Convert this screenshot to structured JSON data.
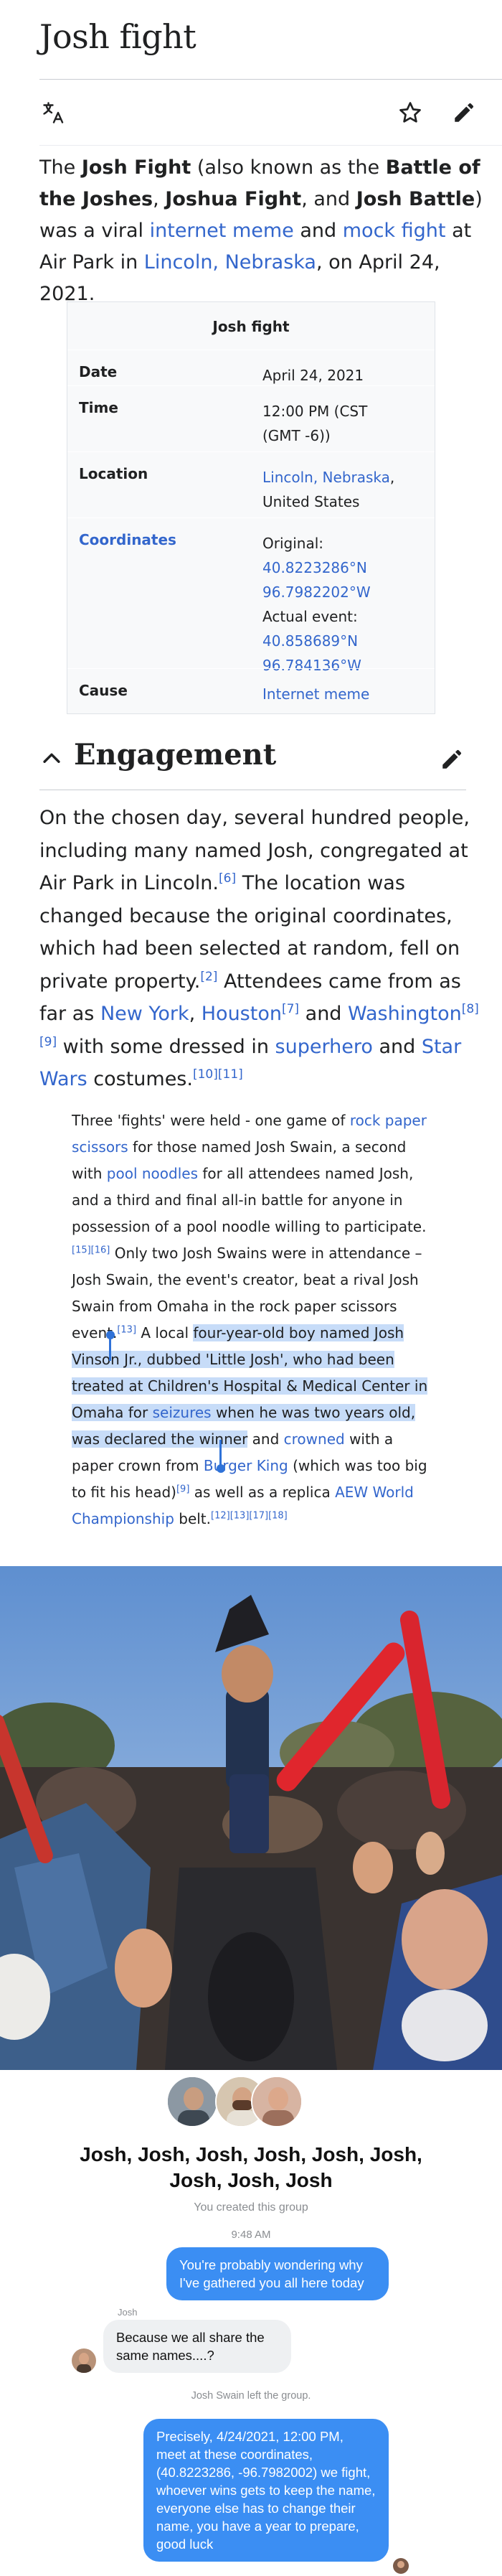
{
  "page": {
    "title": "Josh fight"
  },
  "toolbar": {
    "icons": [
      "translate-icon",
      "star-icon",
      "pencil-icon"
    ]
  },
  "lead": {
    "t1": "The ",
    "b1": "Josh Fight",
    "t2": " (also known as the ",
    "b2": "Battle of the Joshes",
    "t3": ", ",
    "b3": "Joshua Fight",
    "t4": ", and ",
    "b4": "Josh Battle",
    "t5": ") was a viral ",
    "l1": "internet meme",
    "t6": " and ",
    "l2": "mock fight",
    "t7": " at Air Park in ",
    "l3": "Lincoln, Nebraska",
    "t8": ", on April 24, 2021."
  },
  "infobox": {
    "title": "Josh fight",
    "rows": [
      {
        "label": "Date",
        "value": "April 24, 2021"
      },
      {
        "label": "Time",
        "value": "12:00 PM (CST (GMT -6))"
      },
      {
        "label": "Location",
        "value_link": "Lincoln, Nebraska",
        "value_rest": ", United States"
      },
      {
        "label": "Coordinates",
        "original_label": "Original:",
        "original_lat": "40.8223286°N",
        "original_lon": "96.7982202°W",
        "actual_label": "Actual event:",
        "actual_lat": "40.858689°N",
        "actual_lon": "96.784136°W"
      },
      {
        "label": "Cause",
        "value": "Internet meme"
      }
    ]
  },
  "section": {
    "title": "Engagement"
  },
  "engagement": {
    "t1": "On the chosen day, several hundred people, including many named Josh, congregated at Air Park in Lincoln.",
    "r1": "[6]",
    "t2": " The location was changed because the original coordinates, which had been selected at random, fell on private property.",
    "r2": "[2]",
    "t3": " Attendees came from as far as ",
    "l1": "New York",
    "t4": ", ",
    "l2": "Houston",
    "r3": "[7]",
    "t5": " and ",
    "l3": "Washington",
    "r4": "[8][9]",
    "t6": " with some dressed in ",
    "l4": "superhero",
    "t7": " and ",
    "l5": "Star Wars",
    "t8": " costumes.",
    "r5": "[10][11]"
  },
  "quote": {
    "t1": "Three 'fights' were held - one game of ",
    "l1": "rock paper scissors",
    "t2": " for those named Josh Swain, a second with ",
    "l2": "pool noodles",
    "t3": " for all attendees named Josh, and a third and final all-in battle for anyone in possession of a pool noodle willing to participate.",
    "r1": "[15][16]",
    "t4": " Only two Josh Swains were in attendance – Josh Swain, the event's creator, beat a rival Josh Swain from Omaha in the rock paper scissors event.",
    "r2": "[13]",
    "t5": " A local ",
    "s1": "four-year-old boy named Josh Vinson Jr., dubbed 'Little Josh', who had been treated at Children's Hospital & Medical Center in Omaha for ",
    "sl": "seizures",
    "s2": " when he was two years old, was declared the winner",
    "t6": " and ",
    "l3": "crowned",
    "t7": " with a paper crown from ",
    "l4": "Burger King",
    "t8": " (which was too big to fit his head)",
    "r3": "[9]",
    "t9": " as well as a replica ",
    "l5": "AEW World Championship",
    "t10": " belt.",
    "r4": "[12][13][17][18]"
  },
  "chat": {
    "title": "Josh, Josh, Josh, Josh, Josh, Josh, Josh, Josh, Josh",
    "subtitle": "You created this group",
    "time": "9:48 AM",
    "msg1": "You're probably wondering why I've gathered you all here today",
    "sender": "Josh",
    "msg2": "Because we all share the same names....?",
    "system": "Josh Swain left the group.",
    "msg3": "Precisely, 4/24/2021, 12:00 PM, meet at these coordinates, (40.8223286, -96.7982002) we fight, whoever wins gets to keep the name, everyone else has to change their name, you have a year to prepare, good luck",
    "colors": {
      "outgoing": "#3b8ef3",
      "incoming": "#eef0f2"
    }
  },
  "colors": {
    "link": "#3366cc",
    "text": "#202122",
    "selection": "#c7dcf8"
  }
}
